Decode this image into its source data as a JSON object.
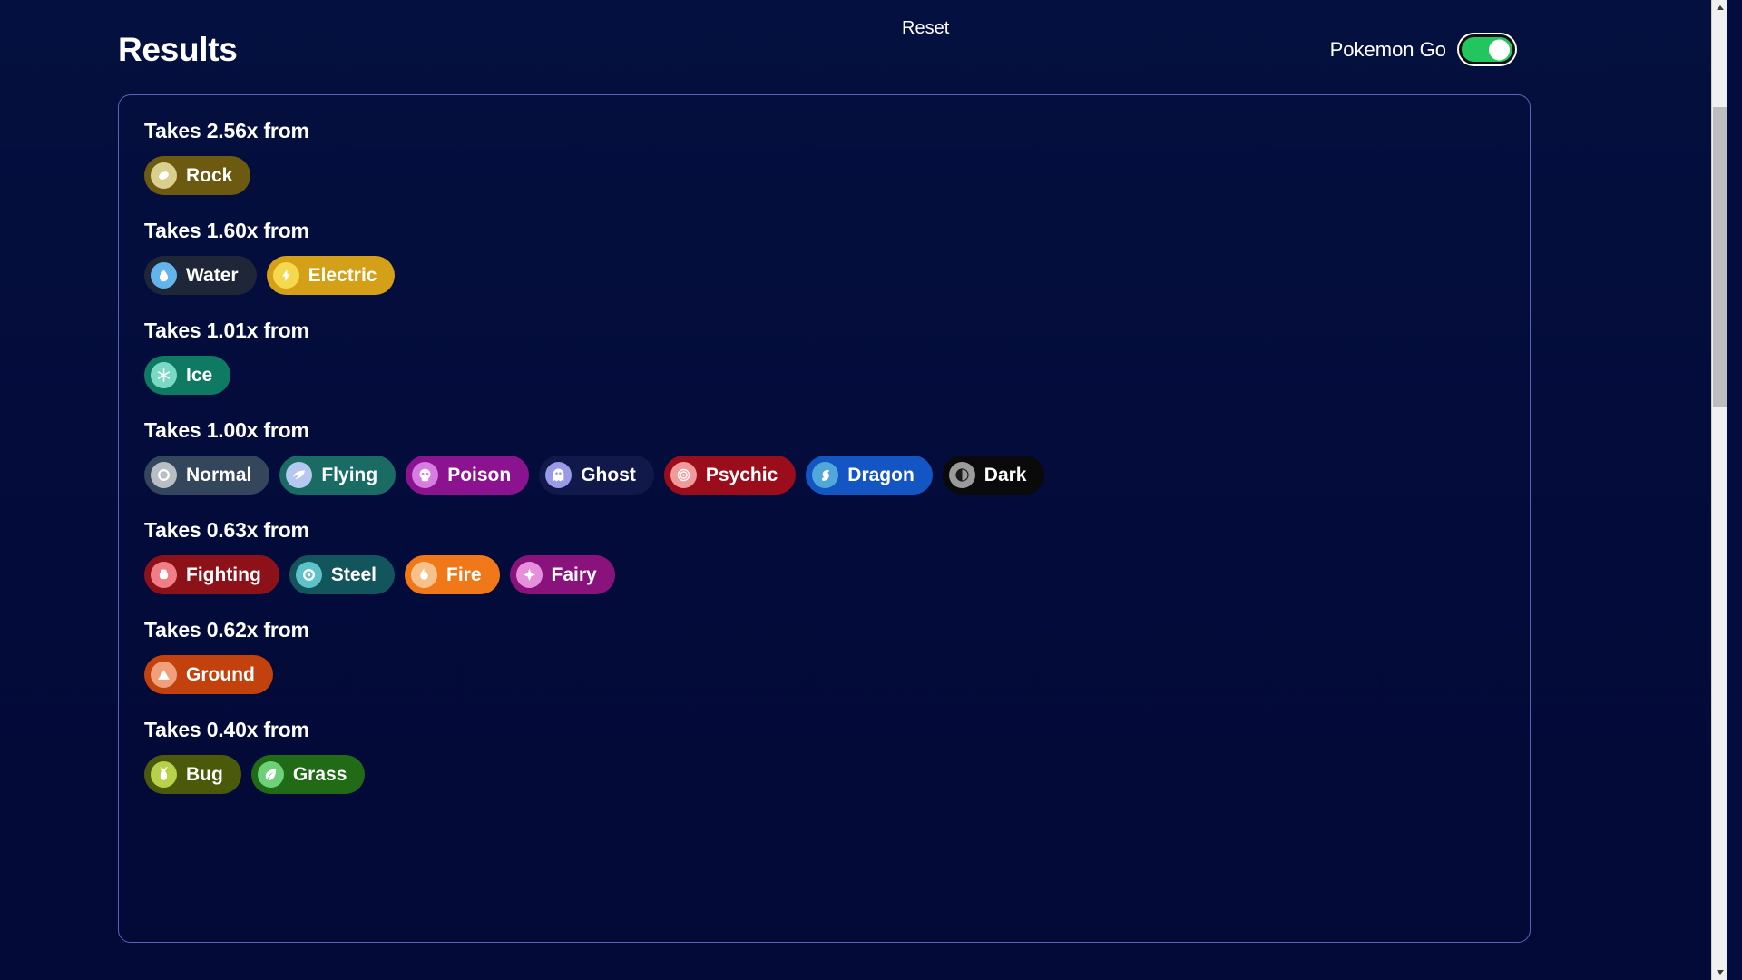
{
  "header": {
    "title": "Results",
    "reset_label": "Reset",
    "mode_label": "Pokemon Go",
    "mode_toggle_state": "on",
    "mode_toggle_color": "#22c55e"
  },
  "card": {
    "border_color": "#5b63b8",
    "background": "#030b3f"
  },
  "groups": [
    {
      "heading": "Takes 2.56x from",
      "multiplier": "2.56x",
      "types": [
        {
          "name": "Rock",
          "bg": "#6b5a10",
          "text": "#ffffff",
          "icon_bg": "#d9cf8f",
          "icon_fg": "#ffffff",
          "icon": "rock-icon"
        }
      ]
    },
    {
      "heading": "Takes 1.60x from",
      "multiplier": "1.60x",
      "types": [
        {
          "name": "Water",
          "bg": "#1e2638",
          "text": "#ffffff",
          "icon_bg": "#63b4ea",
          "icon_fg": "#ffffff",
          "icon": "water-drop-icon"
        },
        {
          "name": "Electric",
          "bg": "#d4a017",
          "text": "#ffffff",
          "icon_bg": "#f4d94e",
          "icon_fg": "#ffffff",
          "icon": "electric-bolt-icon"
        }
      ]
    },
    {
      "heading": "Takes 1.01x from",
      "multiplier": "1.01x",
      "types": [
        {
          "name": "Ice",
          "bg": "#0f7a62",
          "text": "#ffffff",
          "icon_bg": "#7ad9c4",
          "icon_fg": "#ffffff",
          "icon": "snowflake-icon"
        }
      ]
    },
    {
      "heading": "Takes 1.00x from",
      "multiplier": "1.00x",
      "types": [
        {
          "name": "Normal",
          "bg": "#33465c",
          "text": "#ffffff",
          "icon_bg": "#b9bec4",
          "icon_fg": "#ffffff",
          "icon": "circle-icon"
        },
        {
          "name": "Flying",
          "bg": "#1a6b63",
          "text": "#ffffff",
          "icon_bg": "#b6c7f0",
          "icon_fg": "#ffffff",
          "icon": "wing-icon"
        },
        {
          "name": "Poison",
          "bg": "#8b138f",
          "text": "#ffffff",
          "icon_bg": "#d77ce0",
          "icon_fg": "#ffffff",
          "icon": "skull-icon"
        },
        {
          "name": "Ghost",
          "bg": "#10194a",
          "text": "#ffffff",
          "icon_bg": "#9a9ae8",
          "icon_fg": "#ffffff",
          "icon": "ghost-icon"
        },
        {
          "name": "Psychic",
          "bg": "#9c0d1c",
          "text": "#ffffff",
          "icon_bg": "#f09a9a",
          "icon_fg": "#ffffff",
          "icon": "spiral-icon"
        },
        {
          "name": "Dragon",
          "bg": "#1455c4",
          "text": "#ffffff",
          "icon_bg": "#4fa8d8",
          "icon_fg": "#ffffff",
          "icon": "dragon-icon"
        },
        {
          "name": "Dark",
          "bg": "#0a0a0a",
          "text": "#ffffff",
          "icon_bg": "#9b9b9b",
          "icon_fg": "#1a1a1a",
          "icon": "moon-icon"
        }
      ]
    },
    {
      "heading": "Takes 0.63x from",
      "multiplier": "0.63x",
      "types": [
        {
          "name": "Fighting",
          "bg": "#8c1118",
          "text": "#ffffff",
          "icon_bg": "#ef7e86",
          "icon_fg": "#ffffff",
          "icon": "fist-icon"
        },
        {
          "name": "Steel",
          "bg": "#13555c",
          "text": "#ffffff",
          "icon_bg": "#5ec3c9",
          "icon_fg": "#ffffff",
          "icon": "gear-icon"
        },
        {
          "name": "Fire",
          "bg": "#f07818",
          "text": "#ffffff",
          "icon_bg": "#f6c28a",
          "icon_fg": "#ffffff",
          "icon": "flame-icon"
        },
        {
          "name": "Fairy",
          "bg": "#8a127c",
          "text": "#ffffff",
          "icon_bg": "#e68fdc",
          "icon_fg": "#ffffff",
          "icon": "sparkle-icon"
        }
      ]
    },
    {
      "heading": "Takes 0.62x from",
      "multiplier": "0.62x",
      "types": [
        {
          "name": "Ground",
          "bg": "#c2410c",
          "text": "#ffffff",
          "icon_bg": "#f0a07a",
          "icon_fg": "#ffffff",
          "icon": "mountain-icon"
        }
      ]
    },
    {
      "heading": "Takes 0.40x from",
      "multiplier": "0.40x",
      "types": [
        {
          "name": "Bug",
          "bg": "#4a5a0a",
          "text": "#ffffff",
          "icon_bg": "#b8d14a",
          "icon_fg": "#ffffff",
          "icon": "bug-icon"
        },
        {
          "name": "Grass",
          "bg": "#216b16",
          "text": "#ffffff",
          "icon_bg": "#6fd07a",
          "icon_fg": "#ffffff",
          "icon": "leaf-icon"
        }
      ]
    }
  ],
  "scrollbar": {
    "up_arrow": "scroll-up-arrow",
    "down_arrow": "scroll-down-arrow"
  }
}
